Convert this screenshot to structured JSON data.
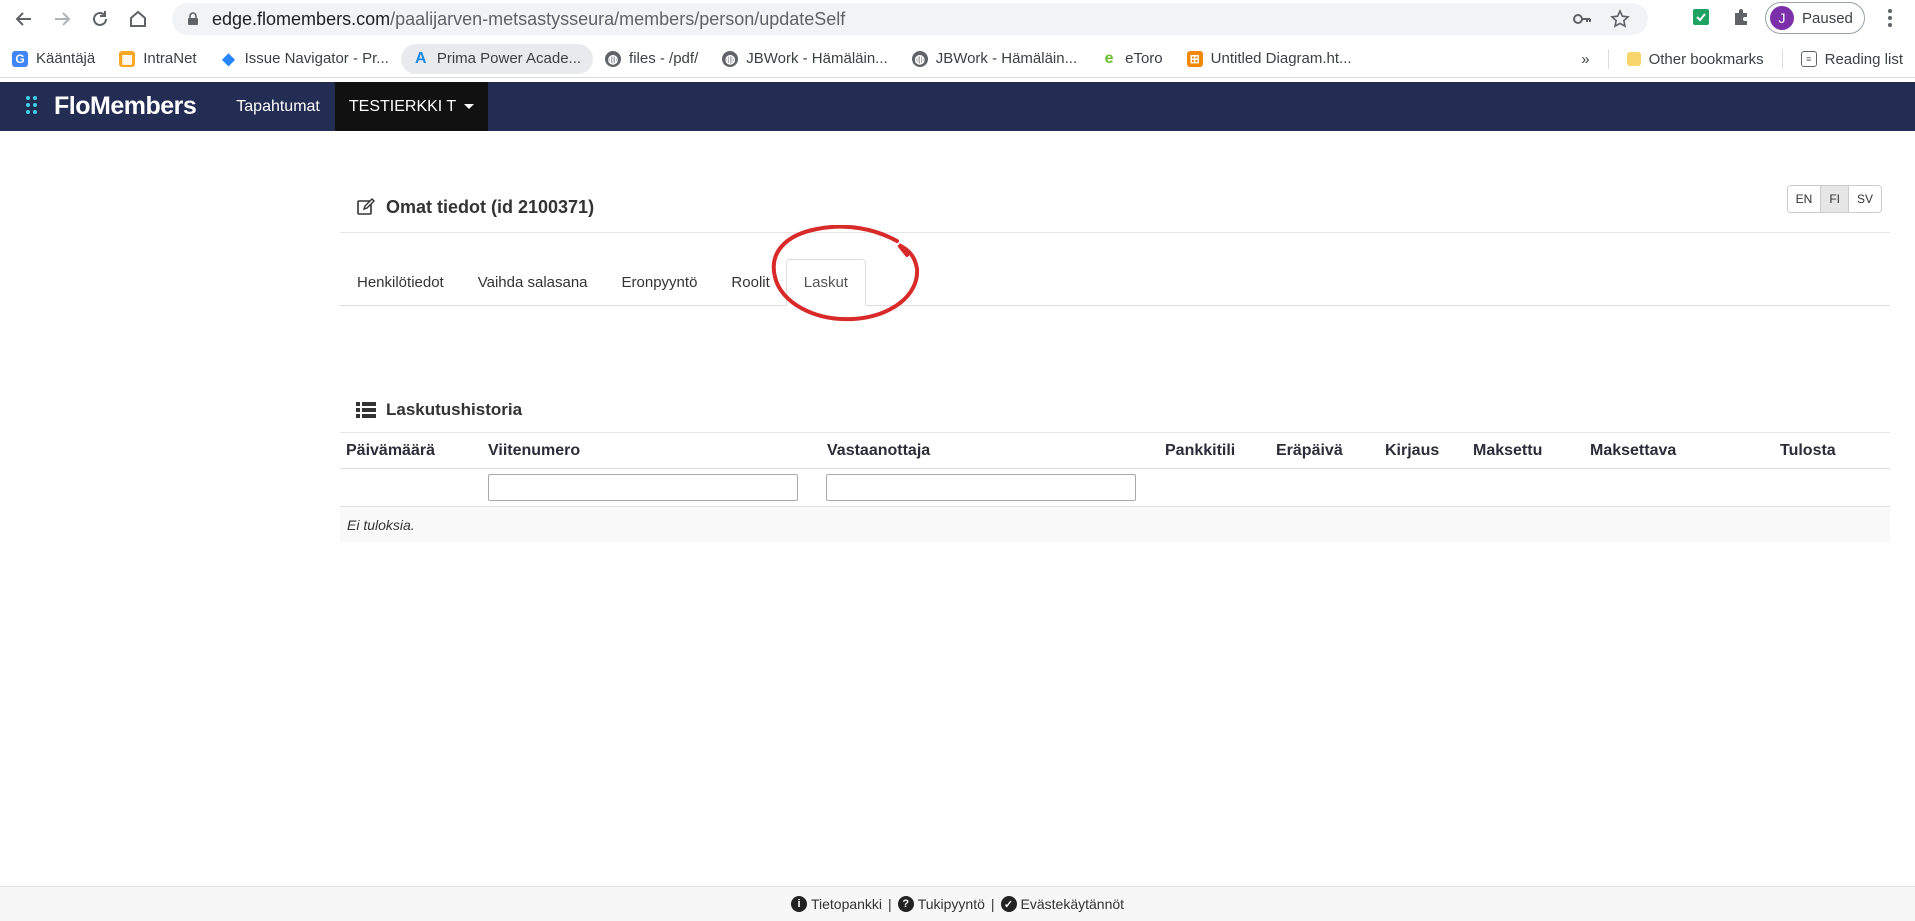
{
  "browser": {
    "url_host": "edge.flomembers.com",
    "url_path": "/paalijarven-metsastysseura/members/person/updateSelf",
    "profile_initial": "J",
    "profile_status": "Paused"
  },
  "bookmarks": [
    {
      "label": "Kääntäjä",
      "icon": "google-translate-icon"
    },
    {
      "label": "IntraNet",
      "icon": "intranet-icon"
    },
    {
      "label": "Issue Navigator - Pr...",
      "icon": "jira-icon"
    },
    {
      "label": "Prima Power Acade...",
      "icon": "prima-power-icon"
    },
    {
      "label": "files - /pdf/",
      "icon": "globe-icon"
    },
    {
      "label": "JBWork - Hämäläin...",
      "icon": "globe-icon"
    },
    {
      "label": "JBWork - Hämäläin...",
      "icon": "globe-icon"
    },
    {
      "label": "eToro",
      "icon": "etoro-icon"
    },
    {
      "label": "Untitled Diagram.ht...",
      "icon": "drawio-icon"
    }
  ],
  "bookmarks_right": {
    "more": "»",
    "other": "Other bookmarks",
    "reading": "Reading list"
  },
  "app": {
    "logo": "FloMembers",
    "nav_events": "Tapahtumat",
    "nav_user": "TESTIERKKI T"
  },
  "page": {
    "title": "Omat tiedot (id 2100371)",
    "languages": [
      "EN",
      "FI",
      "SV"
    ],
    "active_language": "FI",
    "tabs": [
      "Henkilötiedot",
      "Vaihda salasana",
      "Eronpyyntö",
      "Roolit",
      "Laskut"
    ],
    "active_tab": "Laskut"
  },
  "billing": {
    "title": "Laskutushistoria",
    "columns": [
      "Päivämäärä",
      "Viitenumero",
      "Vastaanottaja",
      "Pankkitili",
      "Eräpäivä",
      "Kirjaus",
      "Maksettu",
      "Maksettava",
      "Tulosta"
    ],
    "empty_text": "Ei tuloksia."
  },
  "footer": {
    "items": [
      "Tietopankki",
      "Tukipyyntö",
      "Evästekäytännöt"
    ],
    "separator": "|"
  },
  "colors": {
    "appbar": "#232c52",
    "annotation": "#d92a2a"
  }
}
